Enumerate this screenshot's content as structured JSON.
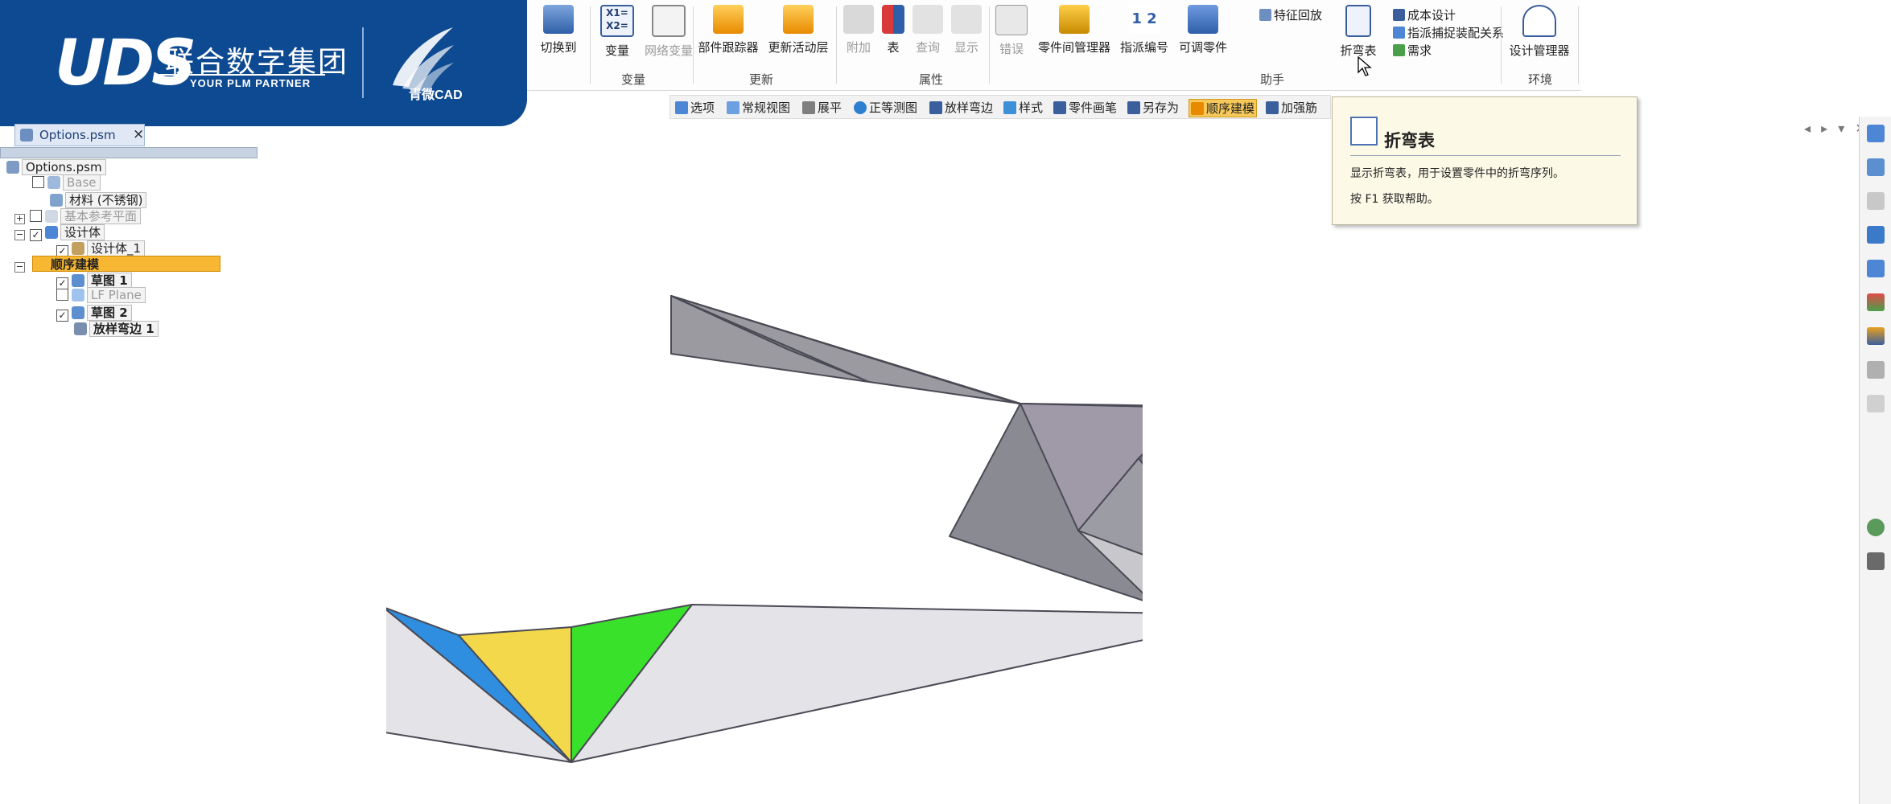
{
  "brand": {
    "logo_text": "UDS",
    "company": "联合数字集团",
    "tagline": "YOUR PLM PARTNER",
    "product": "青微CAD"
  },
  "ribbon": {
    "buttons": [
      {
        "label": "切换到"
      },
      {
        "label": "变量"
      },
      {
        "label": "网络变量"
      },
      {
        "label": "部件跟踪器"
      },
      {
        "label": "更新活动层"
      },
      {
        "label": "附加"
      },
      {
        "label": "表"
      },
      {
        "label": "查询"
      },
      {
        "label": "显示"
      },
      {
        "label": "错误"
      },
      {
        "label": "零件间管理器"
      },
      {
        "label": "指派编号"
      },
      {
        "label": "可调零件"
      },
      {
        "label": "折弯表"
      },
      {
        "label": "设计管理器"
      }
    ],
    "small_items": [
      "特征回放",
      "成本设计",
      "指派捕捉装配关系",
      "需求"
    ],
    "groups": [
      "变量",
      "更新",
      "属性",
      "助手",
      "环境"
    ]
  },
  "commandbar": {
    "items": [
      "选项",
      "常规视图",
      "展平",
      "正等测图",
      "放样弯边",
      "样式",
      "零件画笔",
      "另存为",
      "顺序建模",
      "加强筋"
    ]
  },
  "document_tab": {
    "label": "Options.psm",
    "close": "×"
  },
  "tree": {
    "root": "Options.psm",
    "items": [
      "Base",
      "材料 (不锈钢)",
      "基本参考平面",
      "设计体",
      "设计体_1",
      "顺序建模",
      "草图 1",
      "LF Plane",
      "草图 2",
      "放样弯边 1"
    ]
  },
  "tooltip": {
    "title": "折弯表",
    "description": "显示折弯表，用于设置零件中的折弯序列。",
    "help": "按 F1 获取帮助。"
  },
  "colors": {
    "brand_blue": "#0e4a91",
    "face_blue": "#2f8ee0",
    "face_yellow": "#f2d84a",
    "face_green": "#39e12a",
    "face_gray": "#8e8e94"
  }
}
